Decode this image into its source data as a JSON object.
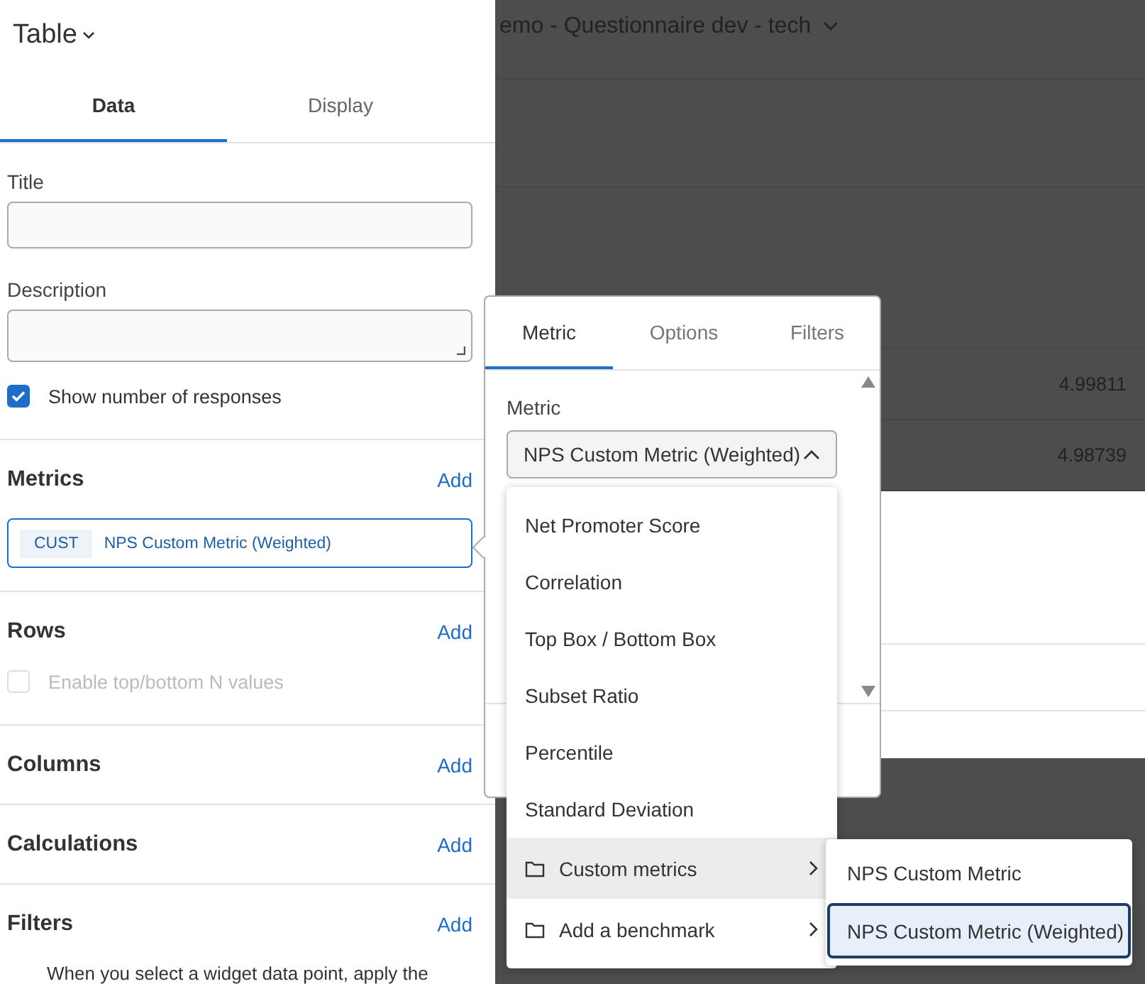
{
  "panel": {
    "title": "Table",
    "tabs": [
      {
        "label": "Data",
        "selected": true
      },
      {
        "label": "Display",
        "selected": false
      }
    ],
    "title_field": {
      "label": "Title"
    },
    "description_field": {
      "label": "Description"
    },
    "show_responses": {
      "label": "Show number of responses",
      "checked": true,
      "disabled": false
    },
    "sections": [
      {
        "heading": "Metrics",
        "action": "Add",
        "metrics": [
          {
            "tag": "CUST",
            "name": "NPS Custom Metric (Weighted)"
          }
        ]
      },
      {
        "heading": "Rows",
        "action": "Add",
        "option": {
          "label": "Enable top/bottom N values",
          "checked": false,
          "disabled": true
        }
      },
      {
        "heading": "Columns",
        "action": "Add"
      },
      {
        "heading": "Calculations",
        "action": "Add"
      },
      {
        "heading": "Filters",
        "action": "Add",
        "note": "When you select a widget data point, apply the"
      }
    ]
  },
  "background": {
    "header_title": "emo - Questionnaire dev - tech",
    "rows": [
      {
        "value": "4.99811"
      },
      {
        "value": "4.98739"
      }
    ]
  },
  "metric_editor": {
    "tabs": [
      {
        "label": "Metric",
        "selected": true
      },
      {
        "label": "Options",
        "selected": false
      },
      {
        "label": "Filters",
        "selected": false
      }
    ],
    "metric_label": "Metric",
    "metric_value": "NPS Custom Metric (Weighted)",
    "expanded": true,
    "options": [
      {
        "label": "Net Promoter Score",
        "kind": "item",
        "highlighted": false
      },
      {
        "label": "Correlation",
        "kind": "item",
        "highlighted": false
      },
      {
        "label": "Top Box / Bottom Box",
        "kind": "item",
        "highlighted": false
      },
      {
        "label": "Subset Ratio",
        "kind": "item",
        "highlighted": false
      },
      {
        "label": "Percentile",
        "kind": "item",
        "highlighted": false
      },
      {
        "label": "Standard Deviation",
        "kind": "item",
        "highlighted": false
      },
      {
        "label": "Custom metrics",
        "kind": "folder",
        "highlighted": true
      },
      {
        "label": "Add a benchmark",
        "kind": "folder",
        "highlighted": false
      }
    ],
    "submenu": [
      {
        "label": "NPS Custom Metric",
        "selected": false
      },
      {
        "label": "NPS Custom Metric (Weighted)",
        "selected": true
      }
    ]
  }
}
